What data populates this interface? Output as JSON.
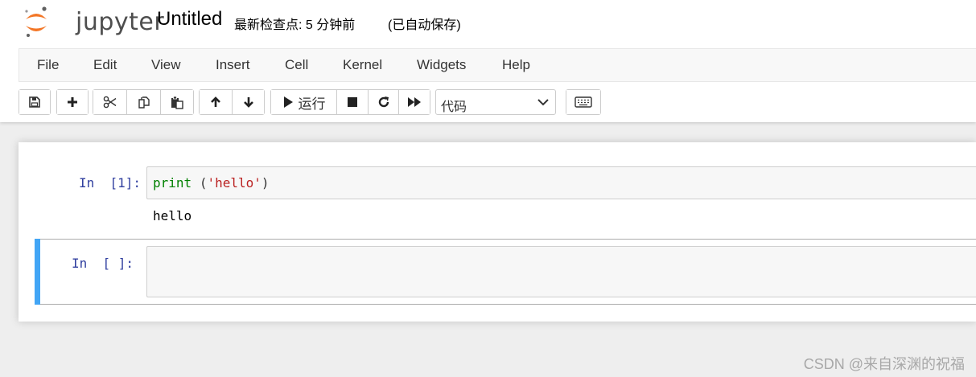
{
  "header": {
    "logo_text": "jupyter",
    "notebook_name": "Untitled",
    "checkpoint_text": "最新检查点: 5 分钟前",
    "autosave_text": "(已自动保存)"
  },
  "menubar": {
    "items": [
      "File",
      "Edit",
      "View",
      "Insert",
      "Cell",
      "Kernel",
      "Widgets",
      "Help"
    ]
  },
  "toolbar": {
    "icons": {
      "save": "save-icon",
      "insert_cell": "plus-icon",
      "cut": "scissors-icon",
      "copy": "copy-icon",
      "paste": "paste-icon",
      "move_up": "arrow-up-icon",
      "move_down": "arrow-down-icon",
      "run": "play-icon",
      "interrupt": "stop-icon",
      "restart": "restart-icon",
      "restart_run_all": "fast-forward-icon",
      "command_palette": "keyboard-icon"
    },
    "run_label": "运行",
    "cell_type": {
      "selected": "代码"
    }
  },
  "cells": [
    {
      "prompt": "In  [1]:",
      "code_tokens": {
        "builtin": "print",
        "space": " ",
        "open": "(",
        "string": "'hello'",
        "close": ")"
      },
      "output": "hello"
    },
    {
      "prompt": "In  [ ]:",
      "code": ""
    }
  ],
  "watermark": "CSDN @来自深渊的祝福",
  "colors": {
    "logo_orange": "#f37626",
    "logo_gray": "#616161",
    "prompt_blue": "#303f9f",
    "selected_cell_bar": "#42a5f5",
    "builtin_green": "#008000",
    "string_red": "#ba2121"
  }
}
